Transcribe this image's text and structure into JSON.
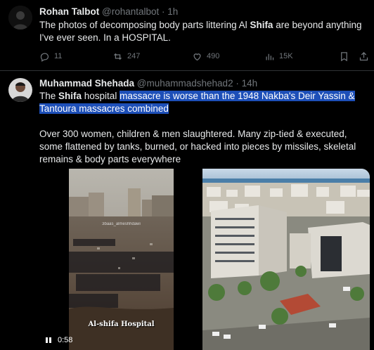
{
  "tweet1": {
    "name": "Rohan Talbot",
    "handle": "@rohantalbot",
    "time": "· 1h",
    "text_before": "The photos of decomposing body parts littering Al ",
    "text_bold": "Shifa",
    "text_after": " are beyond anything I've ever seen. In a HOSPITAL.",
    "replies": "11",
    "reposts": "247",
    "likes": "490",
    "views": "15K"
  },
  "tweet2": {
    "name": "Muhammad Shehada",
    "handle": "@muhammadshehad2",
    "time": "· 14h",
    "line1_a": "The ",
    "line1_bold": "Shifa",
    "line1_b": " hospital ",
    "line1_hl": "massacre is worse than the 1948 Nakba's Deir Yassin &",
    "line2_hl": "Tantoura massacres combined",
    "para2": "Over 300 women, children & men slaughtered. Many zip-tied & executed, some flattened by tanks, burned, or hacked into pieces by missiles, skeletal remains & body parts everywhere",
    "video_duration": "0:58",
    "video_watermark": "3baas_almeshhdawi",
    "video_caption": "Al-shifa Hospital"
  },
  "colors": {
    "background": "#000000",
    "text": "#e7e9ea",
    "muted": "#71767b",
    "highlight": "#1d4fb8",
    "divider": "#2f3336"
  },
  "icons": [
    "reply-icon",
    "repost-icon",
    "like-icon",
    "views-icon",
    "bookmark-icon",
    "share-icon",
    "play-icon"
  ]
}
